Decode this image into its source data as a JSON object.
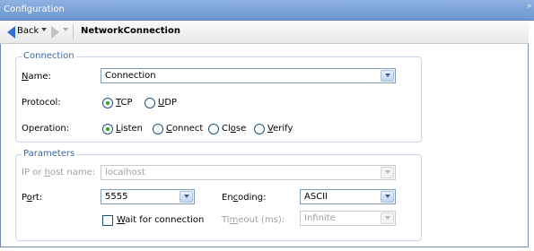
{
  "window": {
    "title": "Configuration",
    "pin_glyph": "ᵖ"
  },
  "nav": {
    "back_label": "Back",
    "title": "NetworkConnection"
  },
  "connection": {
    "legend": "Connection",
    "name_label": "Name:",
    "name_value": "Connection",
    "protocol_label": "Protocol:",
    "protocol_options": [
      "TCP",
      "UDP"
    ],
    "protocol_selected": "TCP",
    "operation_label": "Operation:",
    "operation_options": [
      "Listen",
      "Connect",
      "Close",
      "Verify"
    ],
    "operation_selected": "Listen"
  },
  "parameters": {
    "legend": "Parameters",
    "ip_label": "IP or host name:",
    "ip_value": "localhost",
    "port_label": "Port:",
    "port_value": "5555",
    "encoding_label": "Encoding:",
    "encoding_value": "ASCII",
    "wait_label": "Wait for connection",
    "wait_checked": false,
    "timeout_label": "Timeout (ms):",
    "timeout_value": "Infinite"
  },
  "icons": {
    "back": "left-arrow-icon",
    "forward": "right-arrow-icon",
    "dropdown": "chevron-down-icon",
    "pin": "pin-icon"
  },
  "colors": {
    "titlebar": "#7aa3dc",
    "legend_text": "#3c64a0",
    "radio_dot": "#21a421",
    "input_border": "#7f9db9"
  }
}
